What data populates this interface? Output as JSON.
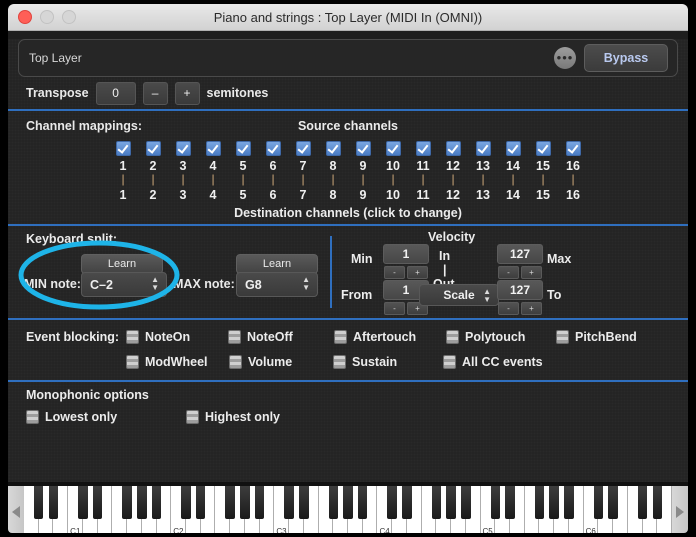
{
  "window": {
    "title": "Piano and strings : Top Layer (MIDI In (OMNI))",
    "traffic": {
      "close": "close-button",
      "minimize": "minimize-button",
      "zoom": "zoom-button"
    }
  },
  "header": {
    "layer_name": "Top Layer",
    "more_label": "•••",
    "bypass_label": "Bypass"
  },
  "transpose": {
    "label": "Transpose",
    "value": "0",
    "minus": "–",
    "plus": "+",
    "units": "semitones"
  },
  "channels": {
    "label": "Channel mappings:",
    "source_title": "Source channels",
    "dest_title": "Destination channels (click to change)",
    "connector": "|",
    "source": [
      "1",
      "2",
      "3",
      "4",
      "5",
      "6",
      "7",
      "8",
      "9",
      "10",
      "11",
      "12",
      "13",
      "14",
      "15",
      "16"
    ],
    "destination": [
      "1",
      "2",
      "3",
      "4",
      "5",
      "6",
      "7",
      "8",
      "9",
      "10",
      "11",
      "12",
      "13",
      "14",
      "15",
      "16"
    ],
    "enabled": [
      true,
      true,
      true,
      true,
      true,
      true,
      true,
      true,
      true,
      true,
      true,
      true,
      true,
      true,
      true,
      true
    ]
  },
  "keyboard_split": {
    "title": "Keyboard split:",
    "min_learn": "Learn",
    "max_learn": "Learn",
    "min_label": "MIN note:",
    "min_value": "C–2",
    "max_label": "MAX note:",
    "max_value": "G8"
  },
  "velocity": {
    "title": "Velocity",
    "in_label": "In",
    "connector": "|",
    "out_label": "Out",
    "min_label": "Min",
    "min_value": "1",
    "max_label": "Max",
    "max_value": "127",
    "from_label": "From",
    "from_value": "1",
    "to_label": "To",
    "to_value": "127",
    "curve_value": "Scale",
    "minus": "-",
    "plus": "+"
  },
  "event_blocking": {
    "label": "Event blocking:",
    "row1": [
      {
        "label": "NoteOn",
        "checked": false
      },
      {
        "label": "NoteOff",
        "checked": false
      },
      {
        "label": "Aftertouch",
        "checked": false
      },
      {
        "label": "Polytouch",
        "checked": false
      },
      {
        "label": "PitchBend",
        "checked": false
      }
    ],
    "row2": [
      {
        "label": "ModWheel",
        "checked": false
      },
      {
        "label": "Volume",
        "checked": false
      },
      {
        "label": "Sustain",
        "checked": false
      },
      {
        "label": "All CC events",
        "checked": false
      }
    ]
  },
  "monophonic": {
    "title": "Monophonic options",
    "options": [
      {
        "label": "Lowest only",
        "checked": false
      },
      {
        "label": "Highest only",
        "checked": false
      }
    ]
  },
  "piano": {
    "scroll_left": "◀",
    "scroll_right": "▶",
    "octave_labels": [
      "C1",
      "C2",
      "C3",
      "C4",
      "C5",
      "C6"
    ]
  },
  "annotation": {
    "shape": "ellipse-highlight",
    "color": "#1eb4e8",
    "target": "min-note-control"
  },
  "colors": {
    "divider": "#2f6fbf",
    "panel_bg": "#242424",
    "accent_text": "#b9c9ef",
    "checkbox_on": "#4a7cc4",
    "highlight": "#1eb4e8"
  }
}
